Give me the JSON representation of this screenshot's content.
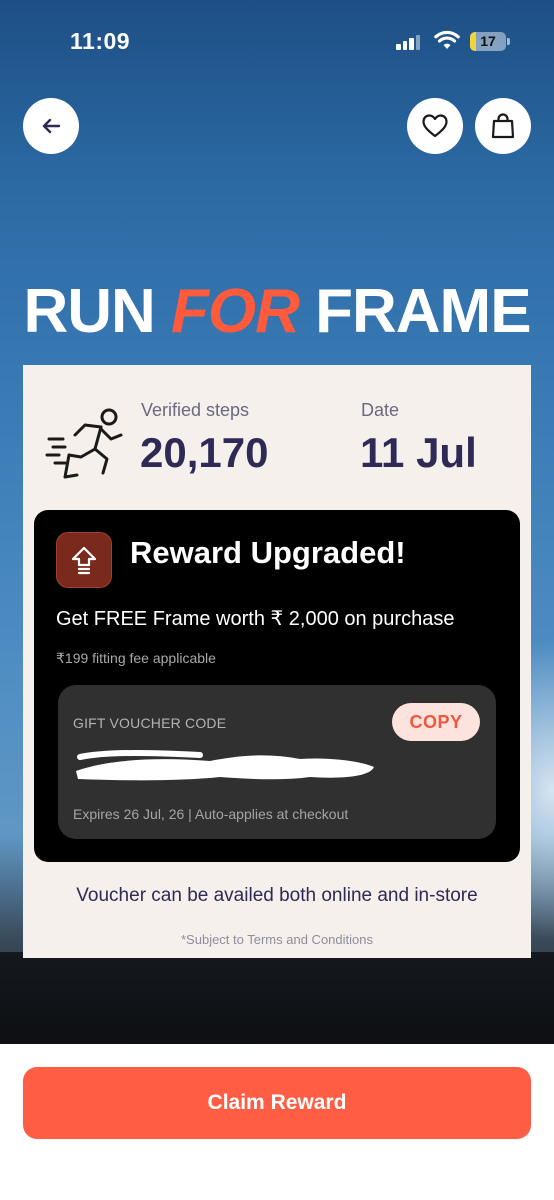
{
  "status_bar": {
    "time": "11:09",
    "battery": "17",
    "battery_level": 0.17
  },
  "header": {
    "title_part1": "RUN",
    "title_part2": "FOR",
    "title_part3": "FRAME"
  },
  "stats": {
    "steps_label": "Verified steps",
    "steps_value": "20,170",
    "date_label": "Date",
    "date_value": "11 Jul"
  },
  "reward": {
    "title": "Reward Upgraded!",
    "description": "Get FREE Frame worth ₹ 2,000 on purchase",
    "fee_note": "₹199 fitting fee applicable",
    "voucher_label": "GIFT VOUCHER CODE",
    "copy_label": "COPY",
    "voucher_expiry": "Expires 26 Jul, 26 | Auto-applies at checkout"
  },
  "availability_note": "Voucher can be availed both online and in-store",
  "terms_note": "*Subject to Terms and Conditions",
  "claim_button": "Claim Reward",
  "icons": {
    "back": "arrow-left-icon",
    "wishlist": "heart-icon",
    "cart": "shopping-bag-icon",
    "runner": "runner-icon",
    "upgrade": "upgrade-arrow-icon"
  },
  "colors": {
    "accent": "#ff5a3c",
    "button": "#ff5e45",
    "navy_text": "#2e2a55",
    "card_bg": "#f5f0ec"
  }
}
